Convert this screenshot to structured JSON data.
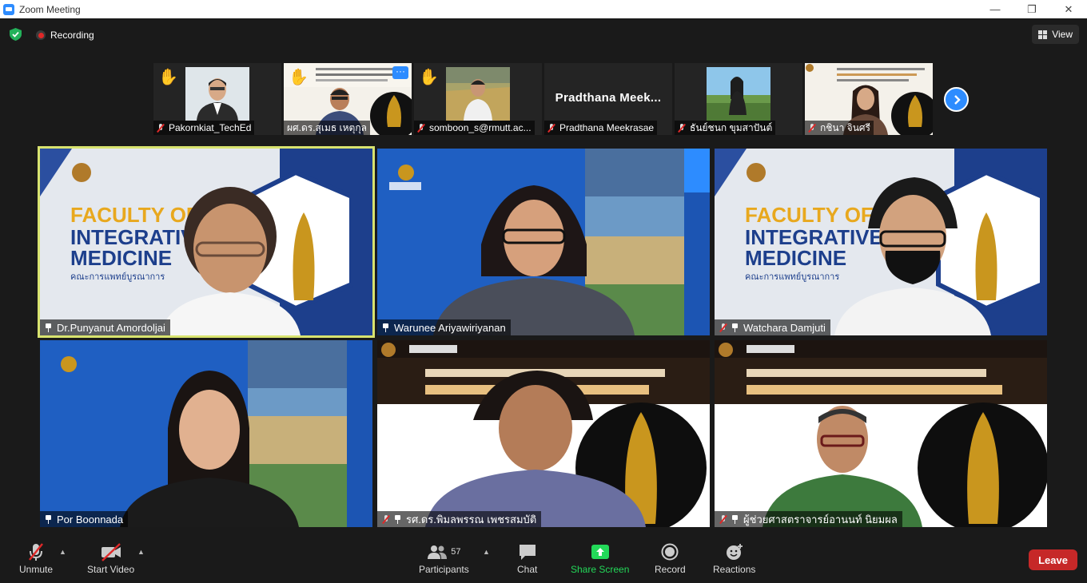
{
  "window": {
    "title": "Zoom Meeting"
  },
  "topbar": {
    "recording_label": "Recording",
    "view_label": "View"
  },
  "thumbnails": [
    {
      "name": "Pakornkiat_TechEd",
      "hand_raised": true
    },
    {
      "name": "ผศ.ดร.สุเมธ เหตุกุล",
      "hand_raised": true,
      "more": "···"
    },
    {
      "name": "somboon_s@rmutt.ac...",
      "hand_raised": true
    },
    {
      "name": "Pradthana Meekrasae",
      "display_text": "Pradthana  Meek..."
    },
    {
      "name": "ธันย์ชนก ขุมสาปันต์"
    },
    {
      "name": "กชินา  จินศรี"
    }
  ],
  "gallery": [
    {
      "name": "Dr.Punyanut Amordoljai",
      "active": true,
      "muted": false,
      "bg_title": "FACULTY OF",
      "bg_line2": "INTEGRATIVE",
      "bg_line3": "MEDICINE",
      "bg_sub": "คณะการแพทย์บูรณาการ"
    },
    {
      "name": "Warunee Ariyawiriyanan",
      "muted": false
    },
    {
      "name": "Watchara Damjuti",
      "muted": true,
      "bg_title": "FACULTY OF",
      "bg_line2": "INTEGRATIVE",
      "bg_line3": "MEDICINE",
      "bg_sub": "คณะการแพทย์บูรณาการ"
    },
    {
      "name": "Por Boonnada",
      "muted": false
    },
    {
      "name": "รศ.ดร.พิมลพรรณ เพชรสมบัติ",
      "muted": true
    },
    {
      "name": "ผู้ช่วยศาสตราจารย์อานนท์ นิยมผล",
      "muted": true
    }
  ],
  "toolbar": {
    "unmute": "Unmute",
    "start_video": "Start Video",
    "participants": "Participants",
    "participants_count": "57",
    "chat": "Chat",
    "share_screen": "Share Screen",
    "record": "Record",
    "reactions": "Reactions",
    "leave": "Leave"
  },
  "colors": {
    "accent": "#2d8cff",
    "share_green": "#23d959",
    "leave_red": "#c62828",
    "active_speaker": "#d8e36f"
  }
}
